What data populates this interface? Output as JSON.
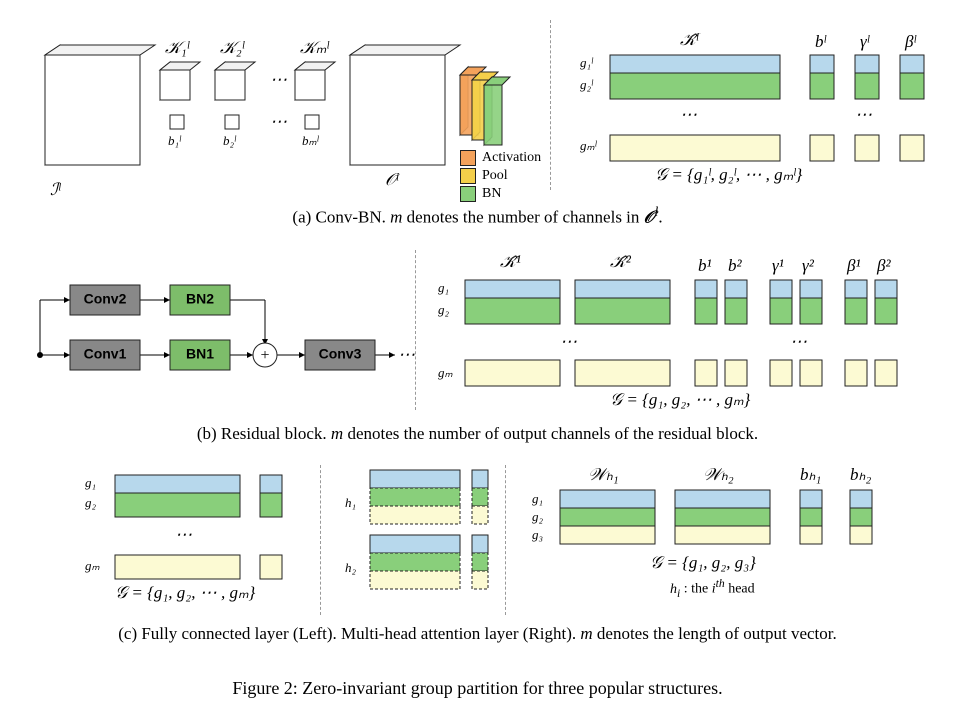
{
  "figure_caption": "Figure 2: Zero-invariant group partition for three popular structures.",
  "panels": {
    "a": {
      "caption": "(a) Conv-BN. m denotes the number of channels in 𝒪ˡ.",
      "labels": {
        "input": "ℐˡ",
        "kernels": [
          "𝒦₁ˡ",
          "𝒦₂ˡ",
          "𝒦ₘˡ"
        ],
        "biases": [
          "b₁ˡ",
          "b₂ˡ",
          "bₘˡ"
        ],
        "output": "𝒪ˡ",
        "legend": [
          "Activation",
          "Pool",
          "BN"
        ],
        "khat": "𝒦̂ˡ",
        "b": "bˡ",
        "gamma": "γˡ",
        "beta": "βˡ",
        "rows": [
          "g₁ˡ",
          "g₂ˡ",
          "gₘˡ"
        ],
        "set": "𝒢 = {g₁ˡ, g₂ˡ, ⋯ , gₘˡ}"
      }
    },
    "b": {
      "caption": "(b) Residual block. m denotes the number of output channels of the residual block.",
      "labels": {
        "blocks": [
          "Conv2",
          "BN2",
          "Conv1",
          "BN1",
          "Conv3"
        ],
        "khat1": "𝒦̂¹",
        "khat2": "𝒦̂²",
        "b1": "b¹",
        "b2": "b²",
        "gamma1": "γ¹",
        "gamma2": "γ²",
        "beta1": "β¹",
        "beta2": "β²",
        "rows": [
          "g₁",
          "g₂",
          "gₘ"
        ],
        "set": "𝒢 = {g₁, g₂, ⋯ , gₘ}"
      }
    },
    "c": {
      "caption": "(c) Fully connected layer (Left). Multi-head attention layer (Right). m denotes the length of output vector.",
      "labels": {
        "left_rows": [
          "g₁",
          "g₂",
          "gₘ"
        ],
        "left_set": "𝒢 = {g₁, g₂, ⋯ , gₘ}",
        "mid_rows": [
          "h₁",
          "h₂"
        ],
        "wh1": "𝒲ₕ₁",
        "wh2": "𝒲ₕ₂",
        "bh1": "bₕ₁",
        "bh2": "bₕ₂",
        "right_rows": [
          "g₁",
          "g₂",
          "g₃"
        ],
        "right_set": "𝒢 = {g₁, g₂, g₃}",
        "note": "hᵢ :  the iᵗʰ head"
      }
    }
  },
  "chart_data": {
    "type": "diagram",
    "title": "Zero-invariant group partition for three popular structures",
    "panels": [
      {
        "id": "a",
        "name": "Conv-BN",
        "description": "Input feature map I^l passes through m convolution kernels K_1..K_m with biases b_1..b_m producing output O^l, followed by Activation, Pool, BN stages. Group partition stacks rows g_1..g_m of K̂^l, b^l, γ^l, β^l; colors blue, green, yellow distinguish groups.",
        "set": "G = {g_1^l, g_2^l, ..., g_m^l}"
      },
      {
        "id": "b",
        "name": "Residual block",
        "description": "Two parallel Conv→BN branches (Conv1/BN1 and Conv2/BN2) summed then fed to Conv3. Group partition over K̂^1, K̂^2, b^1, b^2, γ^1, γ^2, β^1, β^2 rows g_1..g_m.",
        "set": "G = {g_1, g_2, ..., g_m}"
      },
      {
        "id": "c",
        "name": "FC and Multi-head attention",
        "description": "Left: FC layer groups g_1..g_m over weight+bias. Middle: two attention heads h_1,h_2 each with nested groups. Right: weights W_h1,W_h2 and biases b_h1,b_h2 partitioned into g_1,g_2,g_3.",
        "left_set": "G = {g_1, g_2, ..., g_m}",
        "right_set": "G = {g_1, g_2, g_3}",
        "note": "h_i: the i-th head"
      }
    ]
  }
}
